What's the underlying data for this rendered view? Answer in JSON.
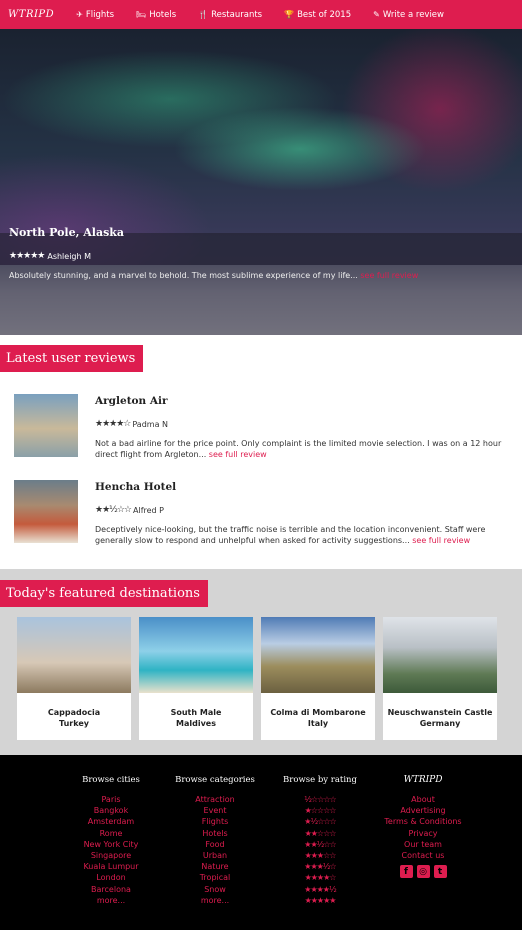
{
  "nav": {
    "logo": "WTRIPD",
    "items": [
      {
        "icon": "plane-icon",
        "glyph": "✈",
        "label": "Flights"
      },
      {
        "icon": "bed-icon",
        "glyph": "🛏",
        "label": "Hotels"
      },
      {
        "icon": "cutlery-icon",
        "glyph": "🍴",
        "label": "Restaurants"
      },
      {
        "icon": "trophy-icon",
        "glyph": "🏆",
        "label": "Best of 2015"
      },
      {
        "icon": "pencil-icon",
        "glyph": "✎",
        "label": "Write a review"
      }
    ]
  },
  "hero": {
    "title": "North Pole, Alaska",
    "stars": "★★★★★",
    "rating": 5,
    "author": "Ashleigh M",
    "text": "Absolutely stunning, and a marvel to behold. The most sublime experience of my life...",
    "more": "see full review"
  },
  "latest": {
    "title": "Latest user reviews",
    "reviews": [
      {
        "title": "Argleton Air",
        "stars": "★★★★☆",
        "rating": 4,
        "author": "Padma N",
        "text": "Not a bad airline for the price point. Only complaint is the limited movie selection. I was on a 12 hour direct flight from Argleton...",
        "more": "see full review"
      },
      {
        "title": "Hencha Hotel",
        "stars": "★★½☆☆",
        "rating": 2.5,
        "author": "Alfred P",
        "text": "Deceptively nice-looking, but the traffic noise is terrible and the location inconvenient. Staff were generally slow to respond and unhelpful when asked for activity suggestions...",
        "more": "see full review"
      }
    ]
  },
  "featured": {
    "title": "Today's featured destinations",
    "cards": [
      {
        "name": "Cappadocia",
        "country": "Turkey"
      },
      {
        "name": "South Male",
        "country": "Maldives"
      },
      {
        "name": "Colma di Mombarone",
        "country": "Italy"
      },
      {
        "name": "Neuschwanstein Castle",
        "country": "Germany"
      }
    ]
  },
  "footer": {
    "cities": {
      "heading": "Browse cities",
      "links": [
        "Paris",
        "Bangkok",
        "Amsterdam",
        "Rome",
        "New York City",
        "Singapore",
        "Kuala Lumpur",
        "London",
        "Barcelona",
        "more..."
      ]
    },
    "categories": {
      "heading": "Browse categories",
      "links": [
        "Attraction",
        "Event",
        "Flights",
        "Hotels",
        "Food",
        "Urban",
        "Nature",
        "Tropical",
        "Snow",
        "more..."
      ]
    },
    "rating": {
      "heading": "Browse by rating",
      "rows": [
        "½☆☆☆☆",
        "★☆☆☆☆",
        "★½☆☆☆",
        "★★☆☆☆",
        "★★½☆☆",
        "★★★☆☆",
        "★★★½☆",
        "★★★★☆",
        "★★★★½",
        "★★★★★"
      ]
    },
    "about": {
      "logo": "WTRIPD",
      "links": [
        "About",
        "Advertising",
        "Terms & Conditions",
        "Privacy",
        "Our team",
        "Contact us"
      ],
      "social": [
        {
          "icon": "facebook-icon",
          "glyph": "f"
        },
        {
          "icon": "instagram-icon",
          "glyph": "◎"
        },
        {
          "icon": "twitter-icon",
          "glyph": "t"
        }
      ]
    }
  },
  "colors": {
    "accent": "#de1d4f",
    "footer_bg": "#000000",
    "featured_bg": "#d4d4d4"
  }
}
